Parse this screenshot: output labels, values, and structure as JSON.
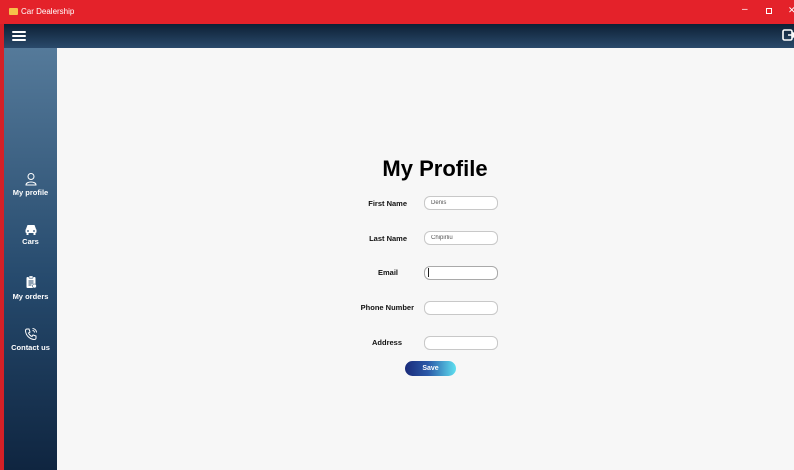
{
  "window": {
    "title": "Car Dealership",
    "minimize_glyph": "–",
    "close_glyph": "✕"
  },
  "header": {
    "menu_icon": "hamburger-menu-icon",
    "logout_icon": "logout-icon"
  },
  "sidebar": {
    "items": [
      {
        "label": "My profile",
        "icon": "user-icon"
      },
      {
        "label": "Cars",
        "icon": "car-icon"
      },
      {
        "label": "My orders",
        "icon": "clipboard-icon"
      },
      {
        "label": "Contact us",
        "icon": "phone-icon"
      }
    ]
  },
  "main": {
    "title": "My Profile",
    "fields": [
      {
        "label": "First Name",
        "value": "Denis"
      },
      {
        "label": "Last Name",
        "value": "Chipirliu"
      },
      {
        "label": "Email",
        "value": ""
      },
      {
        "label": "Phone Number",
        "value": ""
      },
      {
        "label": "Address",
        "value": ""
      }
    ],
    "save_label": "Save"
  },
  "colors": {
    "titlebar": "#e4222a",
    "sidebar_top": "#557a9a",
    "sidebar_bottom": "#0f2540",
    "button_start": "#1a2b7a",
    "button_end": "#5fe0f0"
  }
}
